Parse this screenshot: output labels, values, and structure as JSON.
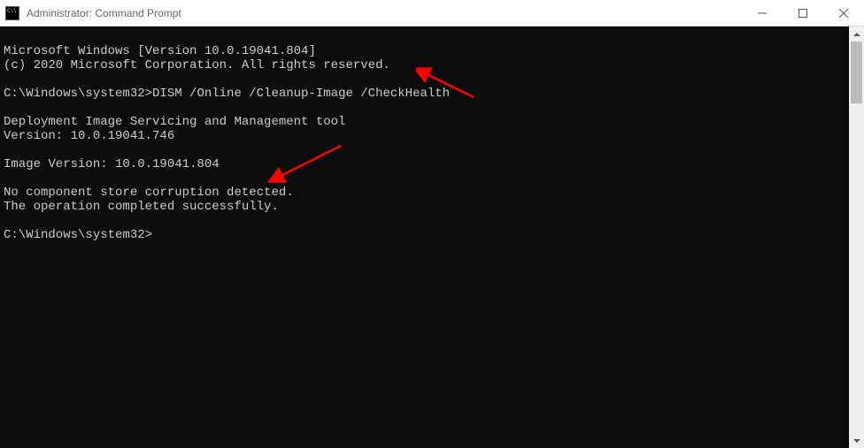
{
  "titlebar": {
    "title": "Administrator: Command Prompt"
  },
  "terminal": {
    "line1": "Microsoft Windows [Version 10.0.19041.804]",
    "line2": "(c) 2020 Microsoft Corporation. All rights reserved.",
    "prompt1_path": "C:\\Windows\\system32>",
    "prompt1_cmd": "DISM /Online /Cleanup-Image /CheckHealth",
    "line4": "Deployment Image Servicing and Management tool",
    "line5": "Version: 10.0.19041.746",
    "line6": "Image Version: 10.0.19041.804",
    "line7": "No component store corruption detected.",
    "line8": "The operation completed successfully.",
    "prompt2_path": "C:\\Windows\\system32>"
  },
  "annotations": {
    "arrow_color": "#ff0000"
  }
}
